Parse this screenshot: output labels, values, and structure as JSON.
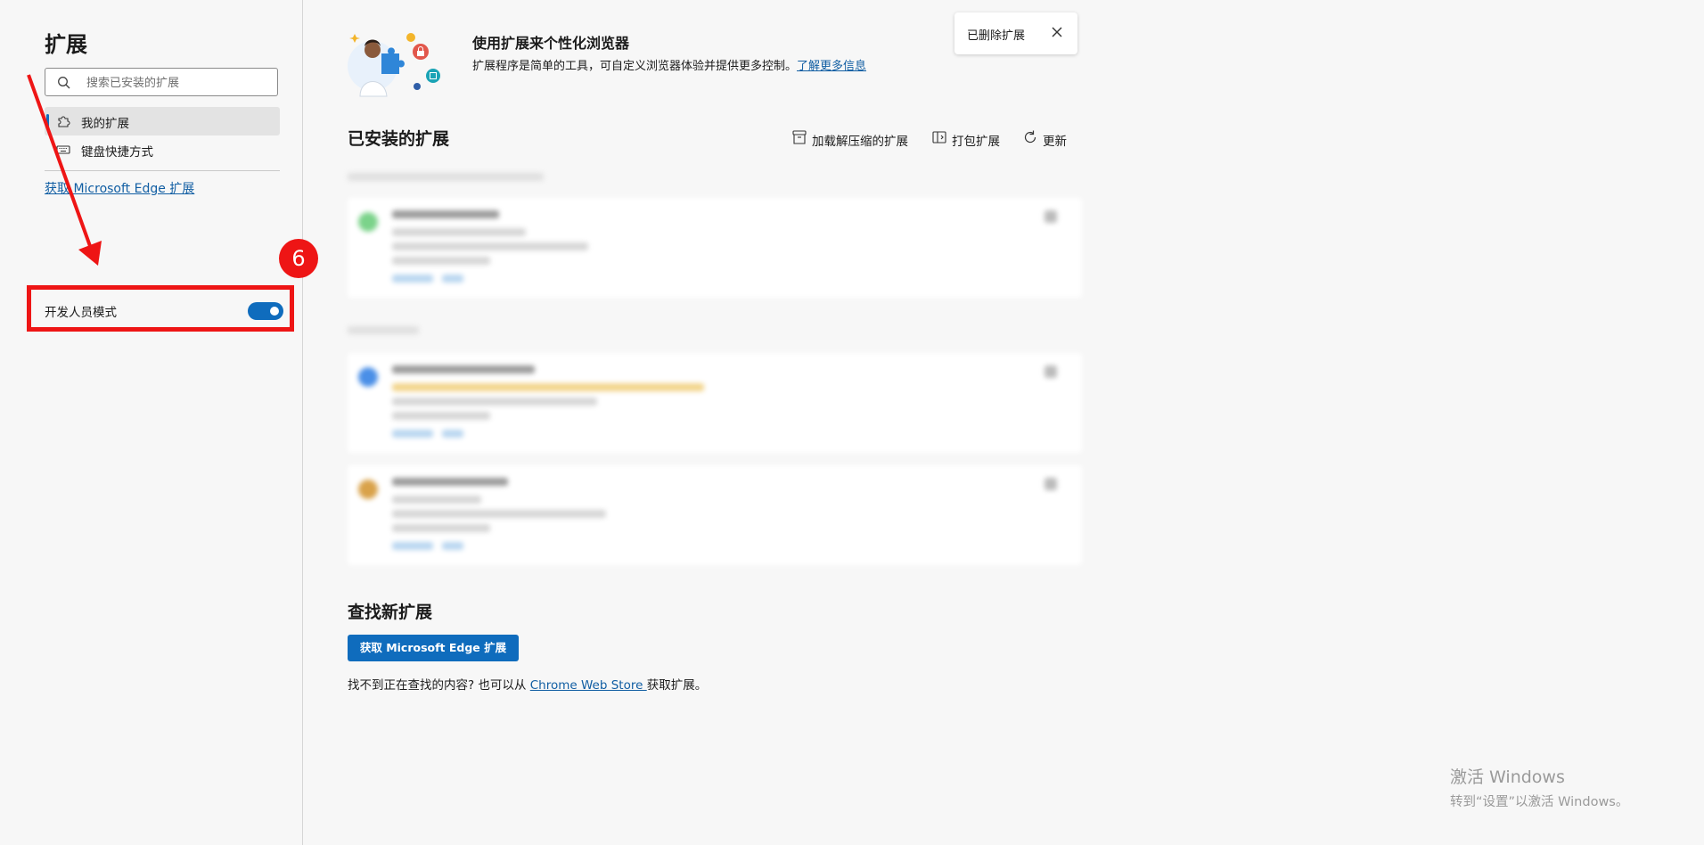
{
  "sidebar": {
    "title": "扩展",
    "search_placeholder": "搜索已安装的扩展",
    "nav": [
      {
        "label": "我的扩展",
        "active": true,
        "icon": "puzzle-icon"
      },
      {
        "label": "键盘快捷方式",
        "active": false,
        "icon": "keyboard-icon"
      }
    ],
    "store_link": "获取 Microsoft Edge 扩展",
    "developer_mode": {
      "label": "开发人员模式",
      "enabled": true
    }
  },
  "annotation": {
    "step_number": "6",
    "color": "#ee1515"
  },
  "hero": {
    "title": "使用扩展来个性化浏览器",
    "description": "扩展程序是简单的工具，可自定义浏览器体验并提供更多控制。",
    "learn_more": "了解更多信息"
  },
  "toast": {
    "message": "已删除扩展",
    "close_icon": "close-icon"
  },
  "installed": {
    "title": "已安装的扩展",
    "actions": [
      {
        "label": "加载解压缩的扩展",
        "icon": "archive-icon"
      },
      {
        "label": "打包扩展",
        "icon": "package-icon"
      },
      {
        "label": "更新",
        "icon": "refresh-icon"
      }
    ]
  },
  "find": {
    "title": "查找新扩展",
    "button": "获取 Microsoft Edge 扩展",
    "text_before": "找不到正在查找的内容? 也可以从 ",
    "link": "Chrome Web Store ",
    "text_after": "获取扩展。"
  },
  "watermark": {
    "line1": "激活 Windows",
    "line2": "转到“设置”以激活 Windows。"
  },
  "colors": {
    "accent": "#0f6cbd",
    "link": "#115ea3",
    "highlight": "#ee1515"
  }
}
